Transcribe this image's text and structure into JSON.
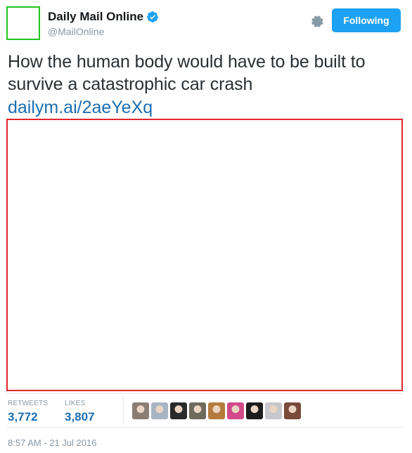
{
  "author": {
    "name": "Daily Mail Online",
    "handle": "@MailOnline",
    "verified_icon": "verified-badge-icon"
  },
  "actions": {
    "settings_icon": "gear-icon",
    "follow_label": "Following"
  },
  "tweet": {
    "text": "How the human body would have to be built to survive a catastrophic car crash",
    "link": "dailym.ai/2aeYeXq"
  },
  "stats": {
    "retweets_label": "RETWEETS",
    "retweets_value": "3,772",
    "likes_label": "LIKES",
    "likes_value": "3,807"
  },
  "likers": [
    {
      "color": "#8a7d74"
    },
    {
      "color": "#a7b4c4"
    },
    {
      "color": "#2a2a2a"
    },
    {
      "color": "#6f6a5e"
    },
    {
      "color": "#b57b3c"
    },
    {
      "color": "#d24a8a"
    },
    {
      "color": "#1c1c1c"
    },
    {
      "color": "#c8c8cc"
    },
    {
      "color": "#7a4a3a"
    }
  ],
  "timestamp": "8:57 AM - 21 Jul 2016",
  "colors": {
    "accent": "#1da1f2",
    "link": "#1b6eb2",
    "muted": "#8899a6",
    "avatar_border": "#22c41f",
    "media_border": "#e0262b"
  }
}
